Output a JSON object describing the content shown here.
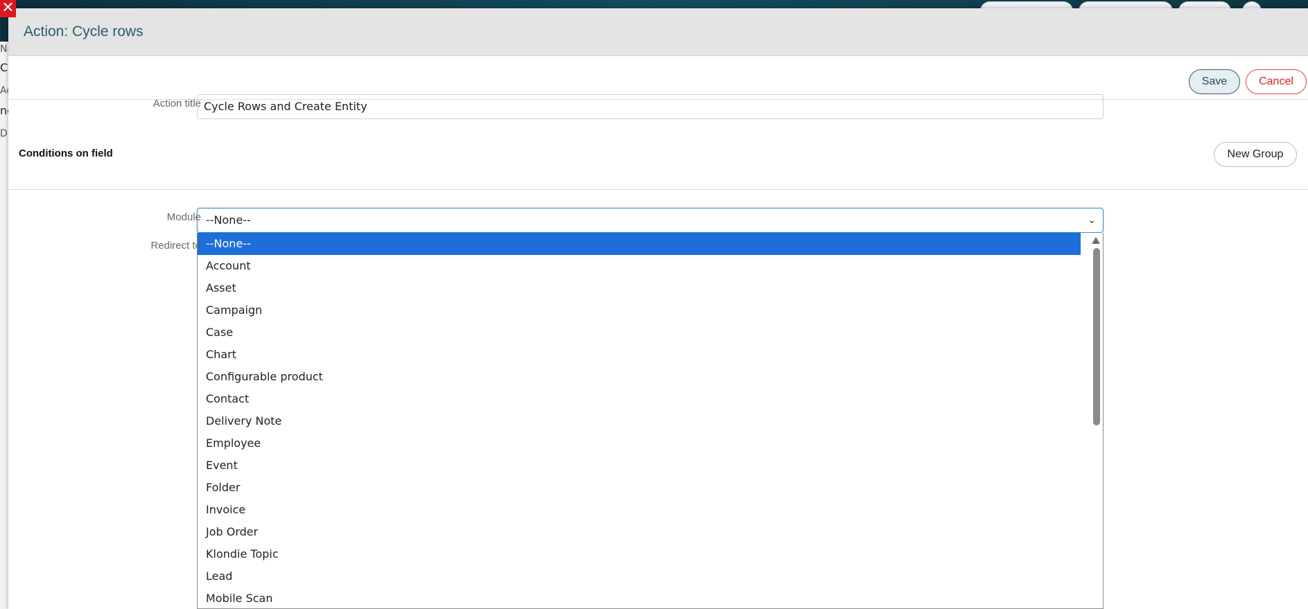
{
  "modal": {
    "title": "Action: Cycle rows",
    "save_label": "Save",
    "cancel_label": "Cancel"
  },
  "form": {
    "action_title_label": "Action title",
    "action_title_value": "Cycle Rows and Create Entity",
    "conditions_title": "Conditions on field",
    "new_group_label": "New Group",
    "module_label": "Module",
    "module_value": "--None--",
    "redirect_label": "Redirect to"
  },
  "dropdown": {
    "options": [
      "--None--",
      "Account",
      "Asset",
      "Campaign",
      "Case",
      "Chart",
      "Configurable product",
      "Contact",
      "Delivery Note",
      "Employee",
      "Event",
      "Folder",
      "Invoice",
      "Job Order",
      "Klondie Topic",
      "Lead",
      "Mobile Scan"
    ],
    "selected_index": 0
  },
  "background": {
    "close_glyph": "✕",
    "side_fragments": [
      "Na",
      "Cy",
      "Ac",
      "nc",
      "Di"
    ]
  },
  "colors": {
    "accent": "#1d6ed8",
    "title": "#2a5a72",
    "cancel": "#d62020"
  }
}
